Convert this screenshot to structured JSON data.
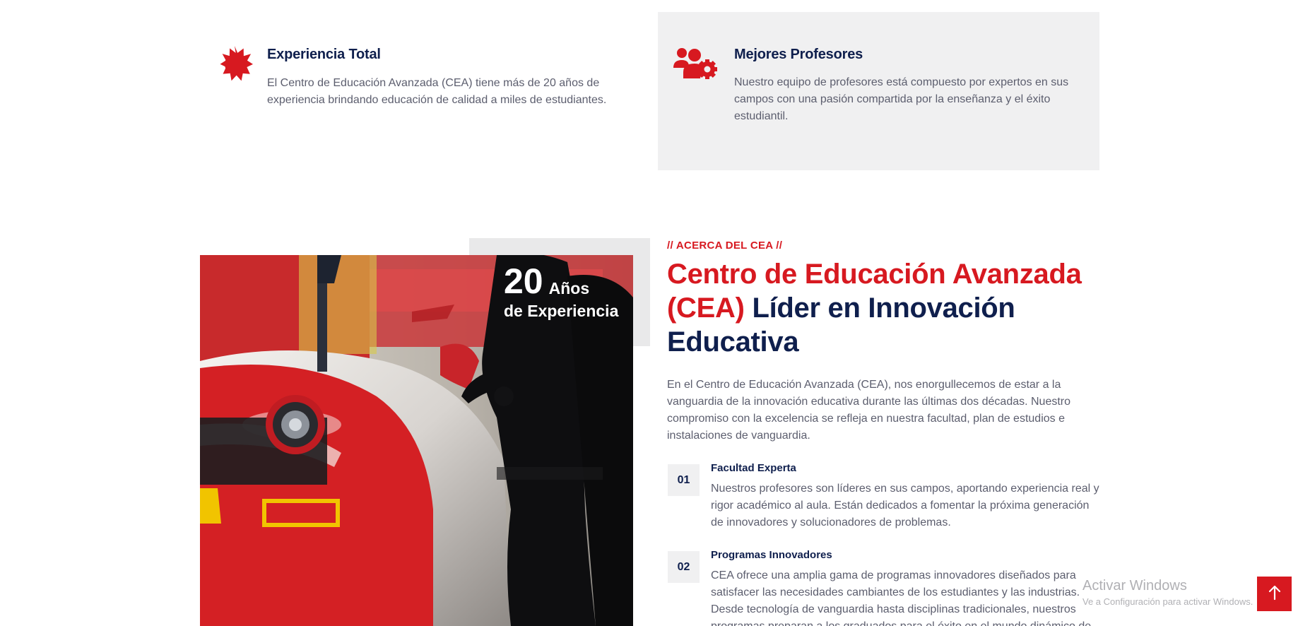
{
  "features": [
    {
      "icon": "badge-starburst-icon",
      "title": "Experiencia Total",
      "text": "El Centro de Educación Avanzada (CEA) tiene más de 20 años de experiencia brindando educación de calidad a miles de estudiantes."
    },
    {
      "icon": "users-gear-icon",
      "title": "Mejores Profesores",
      "text": "Nuestro equipo de profesores está compuesto por expertos en sus campos con una pasión compartida por la enseñanza y el éxito estudiantil."
    }
  ],
  "about": {
    "image_alt": "race-car-pit-photo",
    "experience": {
      "number": "20",
      "unit": "Años",
      "sub": "de Experiencia"
    },
    "eyebrow": "// ACERCA DEL CEA //",
    "title_red": "Centro de Educación Avanzada (CEA)",
    "title_dark": "Líder en Innovación Educativa",
    "intro": "En el Centro de Educación Avanzada (CEA), nos enorgullecemos de estar a la vanguardia de la innovación educativa durante las últimas dos décadas. Nuestro compromiso con la excelencia se refleja en nuestra facultad, plan de estudios e instalaciones de vanguardia.",
    "points": [
      {
        "number": "01",
        "title": "Facultad Experta",
        "text": "Nuestros profesores son líderes en sus campos, aportando experiencia real y rigor académico al aula. Están dedicados a fomentar la próxima generación de innovadores y solucionadores de problemas."
      },
      {
        "number": "02",
        "title": "Programas Innovadores",
        "text": "CEA ofrece una amplia gama de programas innovadores diseñados para satisfacer las necesidades cambiantes de los estudiantes y las industrias. Desde tecnología de vanguardia hasta disciplinas tradicionales, nuestros programas preparan a los graduados para el éxito en el mundo dinámico de"
      }
    ]
  },
  "watermark": {
    "title": "Activar Windows",
    "subtitle": "Ve a Configuración para activar Windows."
  },
  "scroll_top": {
    "icon": "arrow-up-icon"
  },
  "colors": {
    "accent_red": "#d71920",
    "navy": "#0f1f4d",
    "body_text": "#5c5e6e",
    "panel_gray": "#f0f0f1"
  }
}
